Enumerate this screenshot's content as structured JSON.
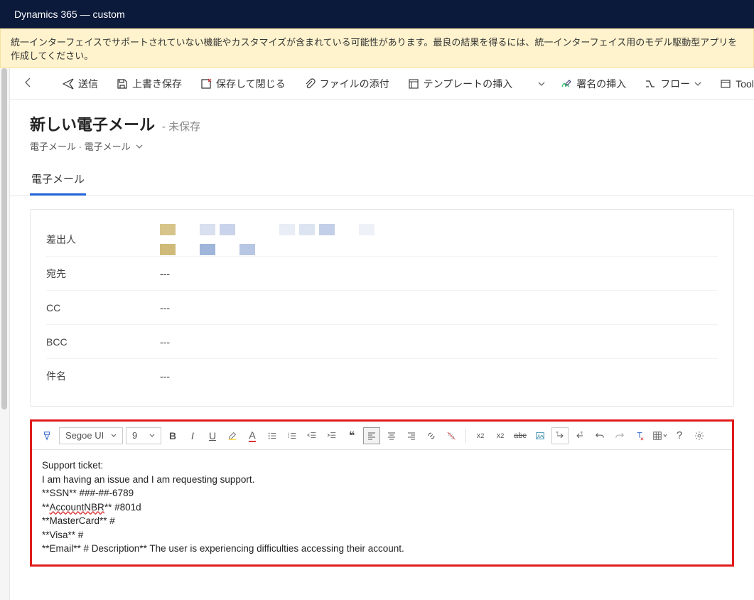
{
  "app": {
    "title": "Dynamics 365 — custom"
  },
  "warning": "統一インターフェイスでサポートされていない機能やカスタマイズが含まれている可能性があります。最良の結果を得るには、統一インターフェイス用のモデル駆動型アプリを作成してください。",
  "commands": {
    "send": "送信",
    "save_draft": "上書き保存",
    "save_close": "保存して閉じる",
    "attach": "ファイルの添付",
    "insert_template": "テンプレートの挿入",
    "insert_signature": "署名の挿入",
    "flow": "フロー",
    "tool": "Tool"
  },
  "record": {
    "title": "新しい電子メール",
    "unsaved": "- 未保存",
    "breadcrumb1": "電子メール",
    "breadcrumb_sep": " · ",
    "breadcrumb2": "電子メール",
    "tab": "電子メール"
  },
  "form": {
    "from_label": "差出人",
    "to_label": "宛先",
    "to_value": "---",
    "cc_label": "CC",
    "cc_value": "---",
    "bcc_label": "BCC",
    "bcc_value": "---",
    "subject_label": "件名",
    "subject_value": "---"
  },
  "editor": {
    "font_family": "Segoe UI",
    "font_size": "9",
    "body_lines": [
      "Support ticket:",
      "I am having an issue and I am requesting support.",
      "**SSN** ###-##-6789",
      "**AccountNBR** #801d",
      "**MasterCard** #",
      "**Visa** #",
      "**Email** # Description** The user is experiencing difficulties accessing their account."
    ],
    "spell_error_word": "AccountNBR"
  }
}
